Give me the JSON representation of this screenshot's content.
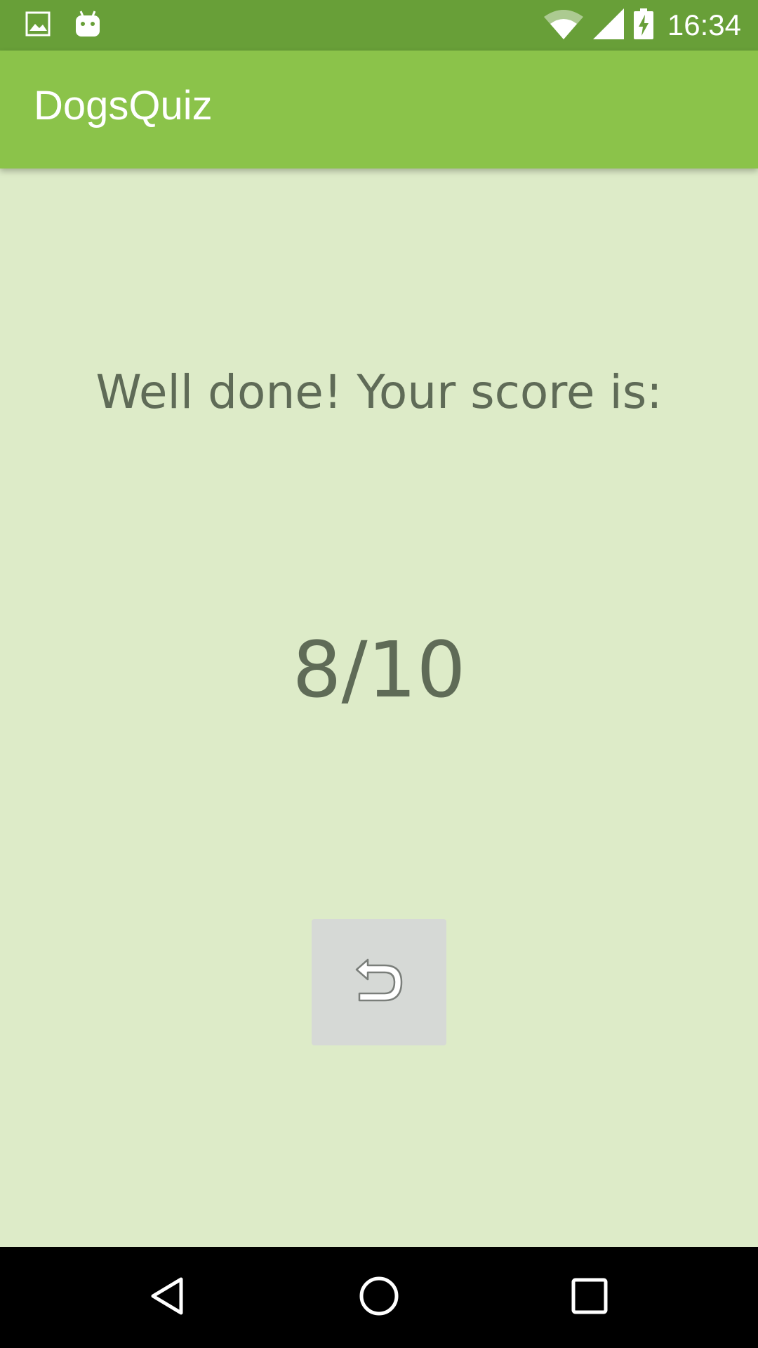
{
  "status_bar": {
    "time": "16:34",
    "icons": [
      "image-icon",
      "android-icon",
      "wifi-icon",
      "cell-signal-icon",
      "battery-charging-icon"
    ]
  },
  "app_bar": {
    "title": "DogsQuiz"
  },
  "result": {
    "message": "Well done! Your score is:",
    "score": "8/10"
  },
  "actions": {
    "replay_icon": "undo-arrow-icon"
  },
  "nav_bar": {
    "icons": [
      "back-icon",
      "home-icon",
      "recents-icon"
    ]
  },
  "colors": {
    "status_bar": "#689F38",
    "app_bar": "#8BC34A",
    "background": "#DDEBC8",
    "text": "#5F6B57",
    "button": "#D6D9D6"
  }
}
